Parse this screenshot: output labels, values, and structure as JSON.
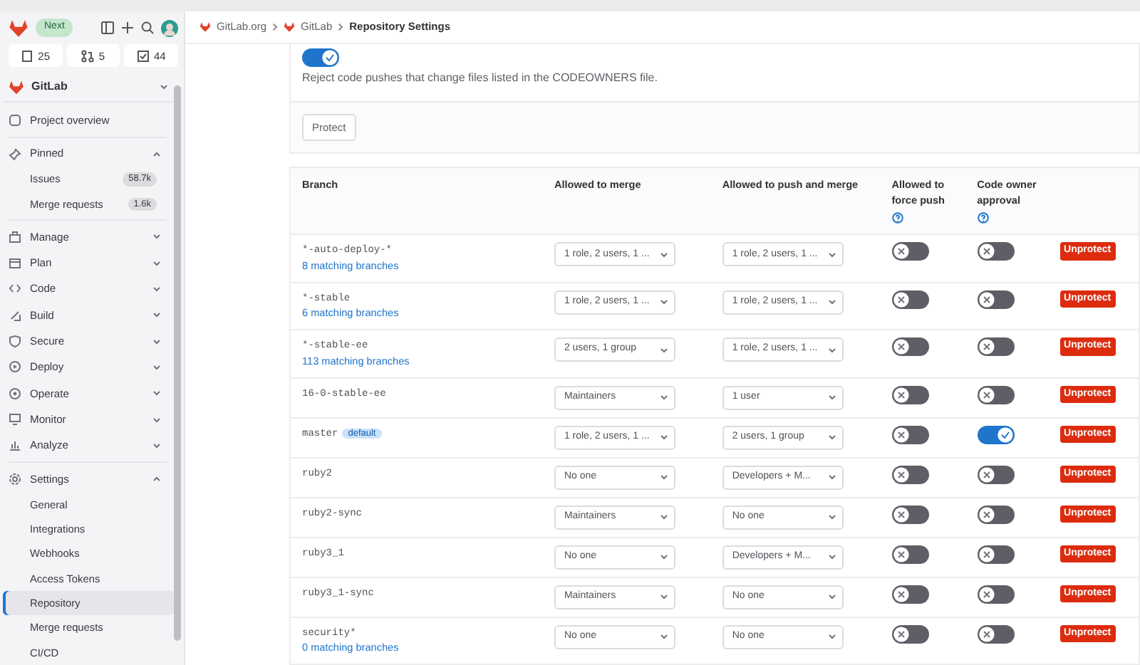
{
  "sidebar": {
    "badge": "Next",
    "counts": [
      {
        "kind": "issues",
        "value": "25"
      },
      {
        "kind": "merge",
        "value": "5"
      },
      {
        "kind": "todo",
        "value": "44"
      }
    ],
    "project": "GitLab",
    "overview": "Project overview",
    "pinned": {
      "label": "Pinned",
      "expanded": true,
      "items": [
        {
          "label": "Issues",
          "count": "58.7k"
        },
        {
          "label": "Merge requests",
          "count": "1.6k"
        }
      ]
    },
    "sections": [
      {
        "label": "Manage",
        "expanded": false
      },
      {
        "label": "Plan",
        "expanded": false
      },
      {
        "label": "Code",
        "expanded": false
      },
      {
        "label": "Build",
        "expanded": false
      },
      {
        "label": "Secure",
        "expanded": false
      },
      {
        "label": "Deploy",
        "expanded": false
      },
      {
        "label": "Operate",
        "expanded": false
      },
      {
        "label": "Monitor",
        "expanded": false
      },
      {
        "label": "Analyze",
        "expanded": false
      },
      {
        "label": "Settings",
        "expanded": true,
        "children": [
          {
            "label": "General",
            "selected": false
          },
          {
            "label": "Integrations",
            "selected": false
          },
          {
            "label": "Webhooks",
            "selected": false
          },
          {
            "label": "Access Tokens",
            "selected": false
          },
          {
            "label": "Repository",
            "selected": true
          },
          {
            "label": "Merge requests",
            "selected": false
          },
          {
            "label": "CI/CD",
            "selected": false
          }
        ]
      }
    ]
  },
  "breadcrumb": [
    "GitLab.org",
    "GitLab",
    "Repository Settings"
  ],
  "codeowners": {
    "on": true,
    "text": "Reject code pushes that change files listed in the CODEOWNERS file."
  },
  "protect_button": "Protect",
  "table": {
    "columns": [
      {
        "label": "Branch",
        "help": false
      },
      {
        "label": "Allowed to merge",
        "help": false
      },
      {
        "label": "Allowed to push and merge",
        "help": false
      },
      {
        "label": "Allowed to force push",
        "help": true
      },
      {
        "label": "Code owner approval",
        "help": true
      }
    ],
    "rows": [
      {
        "branch": "*-auto-deploy-*",
        "matching": "8 matching branches",
        "merge": "1 role, 2 users, 1 ...",
        "push": "1 role, 2 users, 1 ...",
        "force_push": false,
        "code_owner_approval": false,
        "action": "Unprotect"
      },
      {
        "branch": "*-stable",
        "matching": "6 matching branches",
        "merge": "1 role, 2 users, 1 ...",
        "push": "1 role, 2 users, 1 ...",
        "force_push": false,
        "code_owner_approval": false,
        "action": "Unprotect"
      },
      {
        "branch": "*-stable-ee",
        "matching": "113 matching branches",
        "merge": "2 users, 1 group",
        "push": "1 role, 2 users, 1 ...",
        "force_push": false,
        "code_owner_approval": false,
        "action": "Unprotect"
      },
      {
        "branch": "16-0-stable-ee",
        "merge": "Maintainers",
        "push": "1 user",
        "force_push": false,
        "code_owner_approval": false,
        "action": "Unprotect"
      },
      {
        "branch": "master",
        "badge": "default",
        "merge": "1 role, 2 users, 1 ...",
        "push": "2 users, 1 group",
        "force_push": false,
        "code_owner_approval": true,
        "action": "Unprotect"
      },
      {
        "branch": "ruby2",
        "merge": "No one",
        "push": "Developers + M...",
        "force_push": false,
        "code_owner_approval": false,
        "action": "Unprotect"
      },
      {
        "branch": "ruby2-sync",
        "merge": "Maintainers",
        "push": "No one",
        "force_push": false,
        "code_owner_approval": false,
        "action": "Unprotect"
      },
      {
        "branch": "ruby3_1",
        "merge": "No one",
        "push": "Developers + M...",
        "force_push": false,
        "code_owner_approval": false,
        "action": "Unprotect"
      },
      {
        "branch": "ruby3_1-sync",
        "merge": "Maintainers",
        "push": "No one",
        "force_push": false,
        "code_owner_approval": false,
        "action": "Unprotect"
      },
      {
        "branch": "security*",
        "matching": "0 matching branches",
        "merge": "No one",
        "push": "No one",
        "force_push": false,
        "code_owner_approval": false,
        "action": "Unprotect"
      }
    ]
  }
}
